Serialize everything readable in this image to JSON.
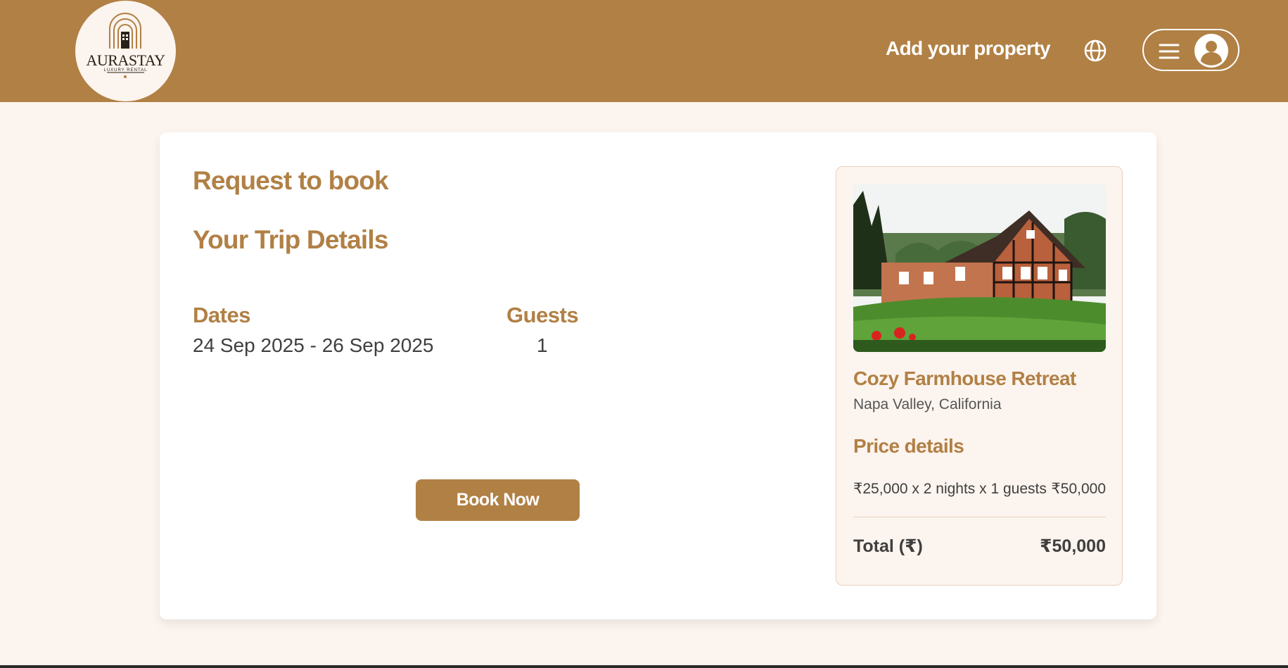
{
  "brand": {
    "logo_word": "AURASTAY",
    "logo_sub": "LUXURY RENTAL",
    "logo_est": "EST"
  },
  "nav": {
    "add_property": "Add your property",
    "language_icon": "globe-icon",
    "menu_icon": "hamburger-icon",
    "profile_icon": "user-avatar-icon"
  },
  "booking": {
    "title": "Request to book",
    "trip_title": "Your Trip Details",
    "dates_label": "Dates",
    "dates_value": "24 Sep 2025 - 26 Sep 2025",
    "guests_label": "Guests",
    "guests_value": "1",
    "book_button": "Book Now"
  },
  "property": {
    "name": "Cozy Farmhouse Retreat",
    "location": "Napa Valley, California"
  },
  "price": {
    "title": "Price details",
    "line_label": "₹25,000 x 2 nights x 1 guests",
    "line_amount": "₹50,000",
    "total_label": "Total (₹)",
    "total_amount": "₹50,000"
  },
  "colors": {
    "brand": "#b18045",
    "page_bg": "#fcf4ee",
    "text_dark": "#3f3f3f"
  }
}
